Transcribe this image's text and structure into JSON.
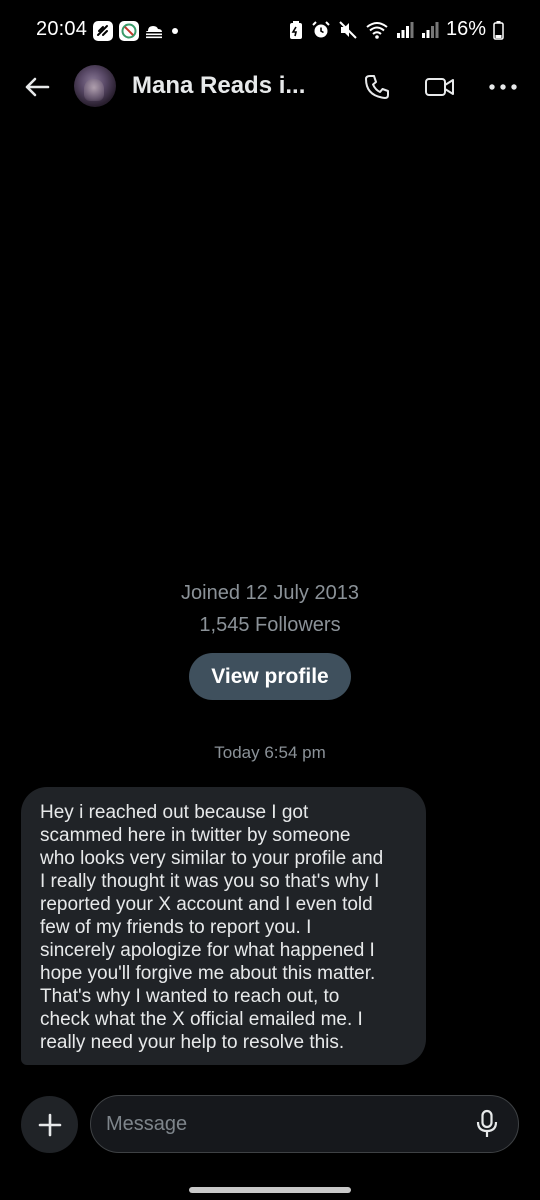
{
  "status_bar": {
    "time": "20:04",
    "battery": "16%",
    "left_icons": [
      "shield-app-icon",
      "messenger-app-icon",
      "cloud-icon",
      "dot-icon"
    ],
    "right_icons": [
      "battery-saver-icon",
      "alarm-icon",
      "mute-icon",
      "wifi-icon",
      "signal-icon",
      "signal-icon",
      "battery-icon"
    ]
  },
  "header": {
    "contact_name": "Mana Reads i...",
    "icons": [
      "back-arrow-icon",
      "phone-icon",
      "video-camera-icon",
      "more-dots-icon"
    ]
  },
  "profile": {
    "joined": "Joined 12 July 2013",
    "followers": "1,545 Followers",
    "view_profile_label": "View profile"
  },
  "conversation": {
    "timestamp": "Today 6:54 pm",
    "messages": [
      {
        "direction": "incoming",
        "text": "Hey i  reached out because I got\nscammed here in twitter by someone\nwho looks very similar to your profile and\nI really thought it was you so that's why I\nreported your X account and I even told\nfew of my friends to report you. I\nsincerely apologize for what happened I\nhope you'll forgive me about this matter.\nThat's why I wanted to reach out, to\ncheck what the X official emailed me. I\nreally need your help to resolve this."
      }
    ]
  },
  "composer": {
    "placeholder": "Message",
    "value": "",
    "icons": [
      "plus-icon",
      "microphone-icon"
    ]
  },
  "colors": {
    "background": "#000000",
    "bubble": "#202327",
    "button": "#3f505d",
    "muted_text": "#8b9298",
    "text": "#e7e9ea"
  }
}
